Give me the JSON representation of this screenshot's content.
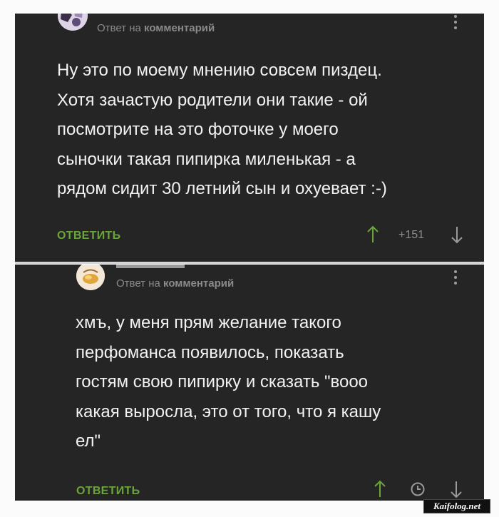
{
  "comments": [
    {
      "avatar_icon": "avatar-icon",
      "reply_prefix": "Ответ на",
      "reply_target": "комментарий",
      "text": "Ну это по моему мнению совсем пиздец.\nХотя зачастую родители они такие - ой\nпосмотрите на это фоточке у моего\nсыночки такая пипирка миленькая - а\nрядом сидит 30 летний сын и охуевает :-)",
      "reply_button": "ОТВЕТИТЬ",
      "score": "+151"
    },
    {
      "avatar_icon": "avatar-icon",
      "reply_prefix": "Ответ на",
      "reply_target": "комментарий",
      "text": "хмъ, у меня прям желание такого\nперфоманса появилось, показать\nгостям свою пипирку и сказать \"вооо\nкакая выросла, это от того, что я кашу\nел\"",
      "reply_button": "ОТВЕТИТЬ"
    }
  ],
  "watermark": "Kaifolog.net",
  "colors": {
    "panel_bg": "#252525",
    "text": "#f2f2f2",
    "muted": "#8a8a8a",
    "accent_green": "#6aa53a"
  }
}
